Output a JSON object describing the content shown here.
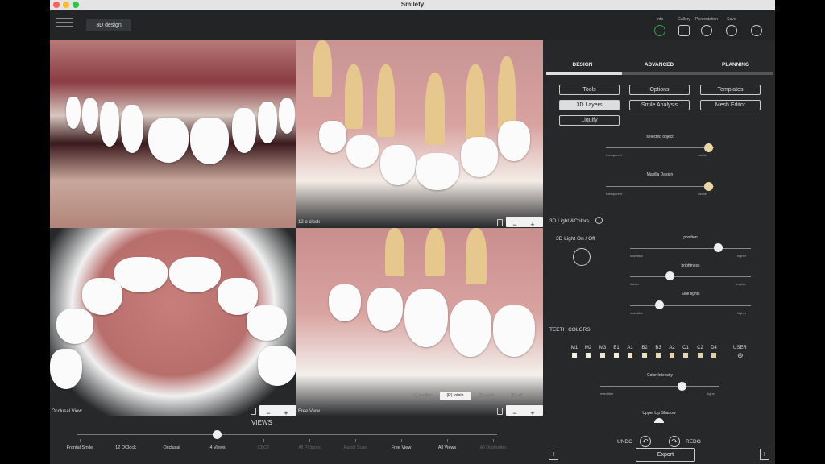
{
  "app": {
    "title": "Smilefy"
  },
  "header": {
    "mode": "3D design"
  },
  "toolbar": [
    {
      "label": "Info",
      "icon": "info-icon"
    },
    {
      "label": "Gallery",
      "icon": "gallery-icon"
    },
    {
      "label": "Presentation",
      "icon": "presentation-icon"
    },
    {
      "label": "Save",
      "icon": "save-icon"
    },
    {
      "label": "",
      "icon": "camera-off-icon"
    }
  ],
  "viewports": {
    "top_right_label": "12 o clock",
    "bottom_left_label": "Occlusal View",
    "bottom_right_label": "Free View",
    "zoom_minus": "−",
    "zoom_plus": "+"
  },
  "modes": [
    {
      "label": "(r) position",
      "selected": false
    },
    {
      "label": "(R) rotate",
      "selected": true
    },
    {
      "label": "(S) scale",
      "selected": false
    },
    {
      "label": "(R) off",
      "selected": false
    }
  ],
  "views": {
    "title": "VIEWS",
    "items": [
      {
        "label": "Frontal Smile",
        "enabled": true
      },
      {
        "label": "12 OClock",
        "enabled": true
      },
      {
        "label": "Occlusal",
        "enabled": true
      },
      {
        "label": "4 Views",
        "enabled": true
      },
      {
        "label": "CBCT",
        "enabled": false
      },
      {
        "label": "All Pictures",
        "enabled": false
      },
      {
        "label": "Facial Scan",
        "enabled": false
      },
      {
        "label": "Free View",
        "enabled": true
      },
      {
        "label": "All Views",
        "enabled": true
      },
      {
        "label": "All Digimatter",
        "enabled": false
      }
    ],
    "selected_index": 3
  },
  "tabs": [
    {
      "label": "DESIGN",
      "active": true
    },
    {
      "label": "ADVANCED",
      "active": false
    },
    {
      "label": "PLANNING",
      "active": false
    }
  ],
  "tool_buttons": [
    {
      "label": "Tools",
      "selected": false
    },
    {
      "label": "Options",
      "selected": false
    },
    {
      "label": "Templates",
      "selected": false
    },
    {
      "label": "3D Layers",
      "selected": true
    },
    {
      "label": "Smile Analysis",
      "selected": false
    },
    {
      "label": "Mesh Editor",
      "selected": false
    },
    {
      "label": "Liquify",
      "selected": false
    }
  ],
  "layers": [
    {
      "name": "selected object",
      "min_label": "transparent",
      "max_label": "visible",
      "value": 1.0
    },
    {
      "name": "Maxilla Design",
      "min_label": "transparent",
      "max_label": "visible",
      "value": 1.0
    }
  ],
  "light": {
    "section_title": "3D Light &Colors",
    "toggle_label": "3D Light On / Off",
    "sliders": [
      {
        "name": "position",
        "min_label": "mandible",
        "max_label": "higher",
        "value": 0.72
      },
      {
        "name": "brightness",
        "min_label": "darker",
        "max_label": "brighter",
        "value": 0.33
      },
      {
        "name": "Side lights",
        "min_label": "mandible",
        "max_label": "higher",
        "value": 0.26
      }
    ]
  },
  "teeth_colors": {
    "title": "TEETH COLORS",
    "shades": [
      "M1",
      "M2",
      "M3",
      "B1",
      "A1",
      "B2",
      "B3",
      "A2",
      "C1",
      "C2",
      "D4"
    ],
    "user_label": "USER",
    "swatch_colors": [
      "#f4f1e6",
      "#f1ecdc",
      "#eee6d0",
      "#f3efdf",
      "#efe5c6",
      "#ece0bd",
      "#e9dab3",
      "#e7d5ab",
      "#e6d7b4",
      "#e3d0a4",
      "#e2cfa2"
    ],
    "intensity": {
      "name": "Color Intensity",
      "min_label": "mandible",
      "max_label": "higher",
      "value": 0.69
    }
  },
  "lip": {
    "name": "Upper Lip Shadow"
  },
  "history": {
    "undo": "UNDO",
    "redo": "REDO"
  },
  "export": {
    "label": "Export"
  },
  "nav": {
    "prev": "‹",
    "next": "›"
  },
  "colors": {
    "accent": "#3aa04a",
    "panel": "#26282a",
    "beige": "#ead7a8"
  }
}
